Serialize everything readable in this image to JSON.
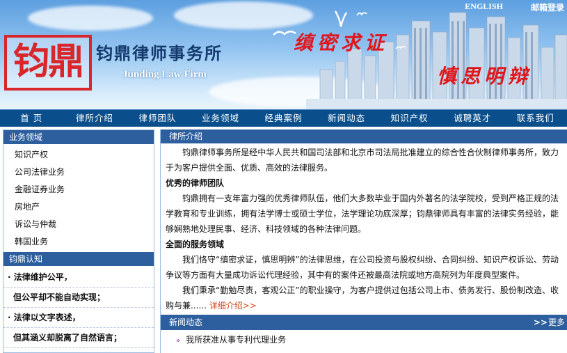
{
  "header": {
    "seal_text": "钧鼎",
    "cn_name": "钧鼎律师事务所",
    "en_name": "Junding Law Firm",
    "slogan_1": "缜密求证",
    "slogan_2": "慎思明辩",
    "links": {
      "english": "ENGLISH",
      "mail_login": "邮箱登录"
    }
  },
  "nav": {
    "items": [
      "首  页",
      "律所介绍",
      "律师团队",
      "业务领域",
      "经典案例",
      "新闻动态",
      "知识产权",
      "诚聘英才",
      "联系我们"
    ]
  },
  "sidebar": {
    "business_title": "业务领域",
    "business_items": [
      "知识产权",
      "公司法律业务",
      "金融证券业务",
      "房地产",
      "诉讼与仲裁",
      "韩国业务"
    ],
    "recognition_title": "钧鼎认知",
    "recognition_lines": [
      "· 法律维护公平，",
      "但公平却不能自动实现；",
      "· 法律以文字表述，",
      "但其涵义却脱离了自然语言；"
    ]
  },
  "main": {
    "intro_title": "律所介绍",
    "para_1": "钧鼎律师事务所是经中华人民共和国司法部和北京市司法局批准建立的综合性合伙制律师事务所，致力于为客户提供全面、优质、高效的法律服务。",
    "subtitle_1": "优秀的律师团队",
    "para_2": "钧鼎拥有一支年富力强的优秀律师队伍，他们大多数毕业于国内外著名的法学院校，受到严格正规的法学教育和专业训练，拥有法学博士或硕士学位，法学理论功底深厚；钧鼎律师具有丰富的法律实务经验，能够娴熟地处理民事、经济、科技领域的各种法律问题。",
    "subtitle_2": "全面的服务领域",
    "para_3": "我们恪守“缜密求证，慎思明辨”的法律思维，在公司投资与股权纠纷、合同纠纷、知识产权诉讼、劳动争议等方面有大量成功诉讼代理经验，其中有的案件还被最高法院或地方高院列为年度典型案件。",
    "para_4": "我们秉承“勤勉尽责，客观公正”的职业操守，为客户提供过包括公司上市、债务发行、股份制改造、收购与兼......",
    "more_detail": "详细介绍>>",
    "news_title": "新闻动态",
    "news_more": "更多",
    "news_items": [
      "我所获准从事专利代理业务"
    ]
  },
  "colors": {
    "nav_bg": "#0a4f8c",
    "section_head_bg": "#2d5f9e",
    "accent_red": "#e0161c"
  }
}
